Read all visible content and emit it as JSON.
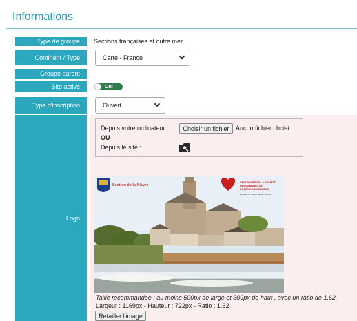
{
  "page_title": "Informations",
  "rows": {
    "type_groupe": {
      "label": "Type de groupe",
      "value": "Sections françaises et outre mer"
    },
    "continent": {
      "label": "Continent / Type",
      "selected": "Carte - France"
    },
    "groupe_parent": {
      "label": "Groupe parent"
    },
    "site_active": {
      "label": "Site activé",
      "toggle_text": "Oui"
    },
    "type_inscription": {
      "label": "Type d'inscription",
      "selected": "Ouvert"
    },
    "logo": {
      "label": "Logo"
    }
  },
  "upload": {
    "from_computer_label": "Depuis votre ordinateur :",
    "choose_file_button": "Choisir un fichier",
    "no_file_text": "Aucun fichier choisi",
    "or_text": "OU",
    "from_site_label": "Depuis le site :"
  },
  "preview": {
    "section_text": "Section de la Nièvre",
    "centenary_text_1": "CENTENAIRE DE LA SOCIÉTÉ",
    "centenary_text_2": "DES MEMBRES DE",
    "centenary_text_3": "LA LÉGION D'HONNEUR",
    "centenary_text_4": "100 ANS AU CŒUR DE LA NATION"
  },
  "notes": {
    "recommended_size": "Taille recommandée : au moins 500px de large et 309px de haut , avec un ratio de 1.62.",
    "dimensions": "Largeur : 1169px - Hauteur : 722px - Ratio : 1.62"
  },
  "resize_button": "Retailler l'image",
  "colors": {
    "accent": "#2ba8be",
    "title": "#2a9bb3",
    "toggle_on": "#2f7d4c",
    "logo_bg": "#fbeeee"
  }
}
